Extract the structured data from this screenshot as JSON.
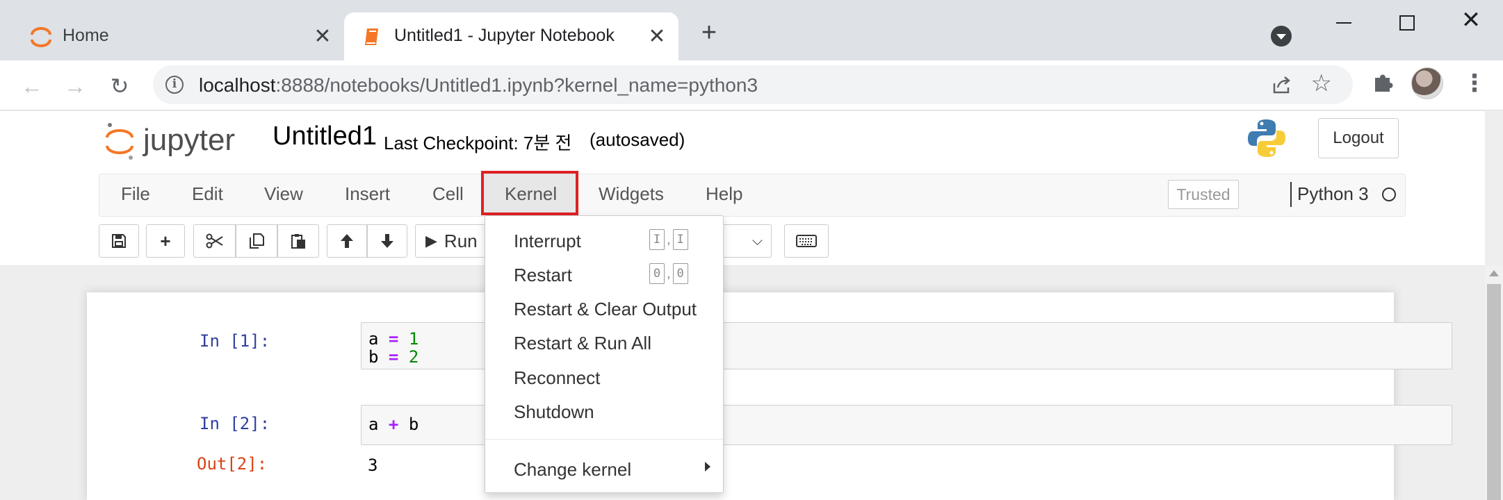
{
  "browser": {
    "tabs": [
      {
        "title": "Home",
        "close": "✕"
      },
      {
        "title": "Untitled1 - Jupyter Notebook",
        "close": "✕"
      }
    ],
    "new_tab": "+",
    "window": {
      "close": "✕"
    },
    "url_host": "localhost",
    "url_rest": ":8888/notebooks/Untitled1.ipynb?kernel_name=python3",
    "nav": {
      "back": "←",
      "forward": "→",
      "reload": "↻",
      "star": "☆",
      "info": "i",
      "menu": "⋮"
    }
  },
  "jupyter": {
    "notebook_name": "Untitled1",
    "checkpoint": "Last Checkpoint: 7분 전",
    "autosaved": "(autosaved)",
    "logout": "Logout",
    "menu": [
      "File",
      "Edit",
      "View",
      "Insert",
      "Cell",
      "Kernel",
      "Widgets",
      "Help"
    ],
    "trusted": "Trusted",
    "kernel_name": "Python 3",
    "toolbar": {
      "add": "+",
      "up": "🡑",
      "down": "🡓",
      "run": "Run",
      "run_icon": "▶",
      "chevron": "⌵"
    },
    "accent": "#f37726",
    "highlight_color": "#dd2124"
  },
  "cells": [
    {
      "prompt": "In [1]:",
      "lines": [
        [
          "a",
          " = ",
          "1"
        ],
        [
          "b",
          " = ",
          "2"
        ]
      ]
    },
    {
      "prompt": "In [2]:",
      "lines": [
        [
          "a",
          " + ",
          "b"
        ]
      ],
      "out_prompt": "Out[2]:",
      "output": "3"
    }
  ],
  "kernel_menu": {
    "items": [
      "Interrupt",
      "Restart",
      "Restart & Clear Output",
      "Restart & Run All",
      "Reconnect",
      "Shutdown",
      "Change kernel"
    ],
    "interrupt_keys": [
      "I",
      "I"
    ],
    "restart_keys": [
      "0",
      "0"
    ],
    "key_sep": ","
  }
}
